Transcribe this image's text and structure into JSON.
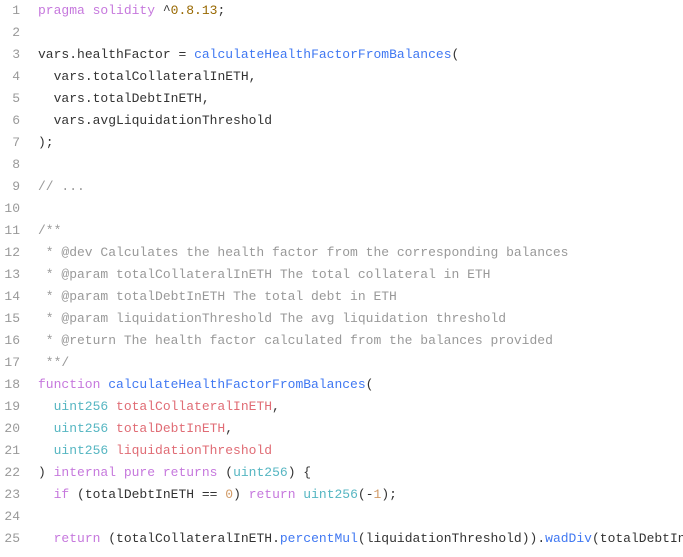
{
  "lines": [
    {
      "n": "1",
      "segs": [
        [
          "kw",
          "pragma "
        ],
        [
          "kw",
          "solidity "
        ],
        [
          "punct",
          "^"
        ],
        [
          "version",
          "0.8.13"
        ],
        [
          "punct",
          ";"
        ]
      ]
    },
    {
      "n": "2",
      "segs": []
    },
    {
      "n": "3",
      "segs": [
        [
          "ident",
          "vars"
        ],
        [
          "punct",
          "."
        ],
        [
          "ident",
          "healthFactor"
        ],
        [
          "op",
          " = "
        ],
        [
          "fn",
          "calculateHealthFactorFromBalances"
        ],
        [
          "punct",
          "("
        ]
      ]
    },
    {
      "n": "4",
      "segs": [
        [
          "ident",
          "  vars"
        ],
        [
          "punct",
          "."
        ],
        [
          "ident",
          "totalCollateralInETH"
        ],
        [
          "punct",
          ","
        ]
      ]
    },
    {
      "n": "5",
      "segs": [
        [
          "ident",
          "  vars"
        ],
        [
          "punct",
          "."
        ],
        [
          "ident",
          "totalDebtInETH"
        ],
        [
          "punct",
          ","
        ]
      ]
    },
    {
      "n": "6",
      "segs": [
        [
          "ident",
          "  vars"
        ],
        [
          "punct",
          "."
        ],
        [
          "ident",
          "avgLiquidationThreshold"
        ]
      ]
    },
    {
      "n": "7",
      "segs": [
        [
          "punct",
          ");"
        ]
      ]
    },
    {
      "n": "8",
      "segs": []
    },
    {
      "n": "9",
      "segs": [
        [
          "comment",
          "// ..."
        ]
      ]
    },
    {
      "n": "10",
      "segs": []
    },
    {
      "n": "11",
      "segs": [
        [
          "comment",
          "/**"
        ]
      ]
    },
    {
      "n": "12",
      "segs": [
        [
          "comment",
          " * @dev Calculates the health factor from the corresponding balances"
        ]
      ]
    },
    {
      "n": "13",
      "segs": [
        [
          "comment",
          " * @param totalCollateralInETH The total collateral in ETH"
        ]
      ]
    },
    {
      "n": "14",
      "segs": [
        [
          "comment",
          " * @param totalDebtInETH The total debt in ETH"
        ]
      ]
    },
    {
      "n": "15",
      "segs": [
        [
          "comment",
          " * @param liquidationThreshold The avg liquidation threshold"
        ]
      ]
    },
    {
      "n": "16",
      "segs": [
        [
          "comment",
          " * @return The health factor calculated from the balances provided"
        ]
      ]
    },
    {
      "n": "17",
      "segs": [
        [
          "comment",
          " **/"
        ]
      ]
    },
    {
      "n": "18",
      "segs": [
        [
          "kw",
          "function "
        ],
        [
          "fn",
          "calculateHealthFactorFromBalances"
        ],
        [
          "punct",
          "("
        ]
      ]
    },
    {
      "n": "19",
      "segs": [
        [
          "type",
          "  uint256 "
        ],
        [
          "param",
          "totalCollateralInETH"
        ],
        [
          "punct",
          ","
        ]
      ]
    },
    {
      "n": "20",
      "segs": [
        [
          "type",
          "  uint256 "
        ],
        [
          "param",
          "totalDebtInETH"
        ],
        [
          "punct",
          ","
        ]
      ]
    },
    {
      "n": "21",
      "segs": [
        [
          "type",
          "  uint256 "
        ],
        [
          "param",
          "liquidationThreshold"
        ]
      ]
    },
    {
      "n": "22",
      "segs": [
        [
          "punct",
          ") "
        ],
        [
          "kw",
          "internal "
        ],
        [
          "kw",
          "pure "
        ],
        [
          "kw",
          "returns "
        ],
        [
          "punct",
          "("
        ],
        [
          "type",
          "uint256"
        ],
        [
          "punct",
          ") {"
        ]
      ]
    },
    {
      "n": "23",
      "segs": [
        [
          "ident",
          "  "
        ],
        [
          "kw",
          "if "
        ],
        [
          "punct",
          "("
        ],
        [
          "ident",
          "totalDebtInETH "
        ],
        [
          "op",
          "== "
        ],
        [
          "num",
          "0"
        ],
        [
          "punct",
          ") "
        ],
        [
          "kw",
          "return "
        ],
        [
          "type",
          "uint256"
        ],
        [
          "punct",
          "("
        ],
        [
          "op",
          "-"
        ],
        [
          "num",
          "1"
        ],
        [
          "punct",
          ");"
        ]
      ]
    },
    {
      "n": "24",
      "segs": []
    },
    {
      "n": "25",
      "segs": [
        [
          "ident",
          "  "
        ],
        [
          "kw",
          "return "
        ],
        [
          "punct",
          "("
        ],
        [
          "ident",
          "totalCollateralInETH"
        ],
        [
          "punct",
          "."
        ],
        [
          "fn",
          "percentMul"
        ],
        [
          "punct",
          "("
        ],
        [
          "ident",
          "liquidationThreshold"
        ],
        [
          "punct",
          "))."
        ],
        [
          "fn",
          "wadDiv"
        ],
        [
          "punct",
          "("
        ],
        [
          "ident",
          "totalDebtInETH"
        ]
      ]
    }
  ]
}
